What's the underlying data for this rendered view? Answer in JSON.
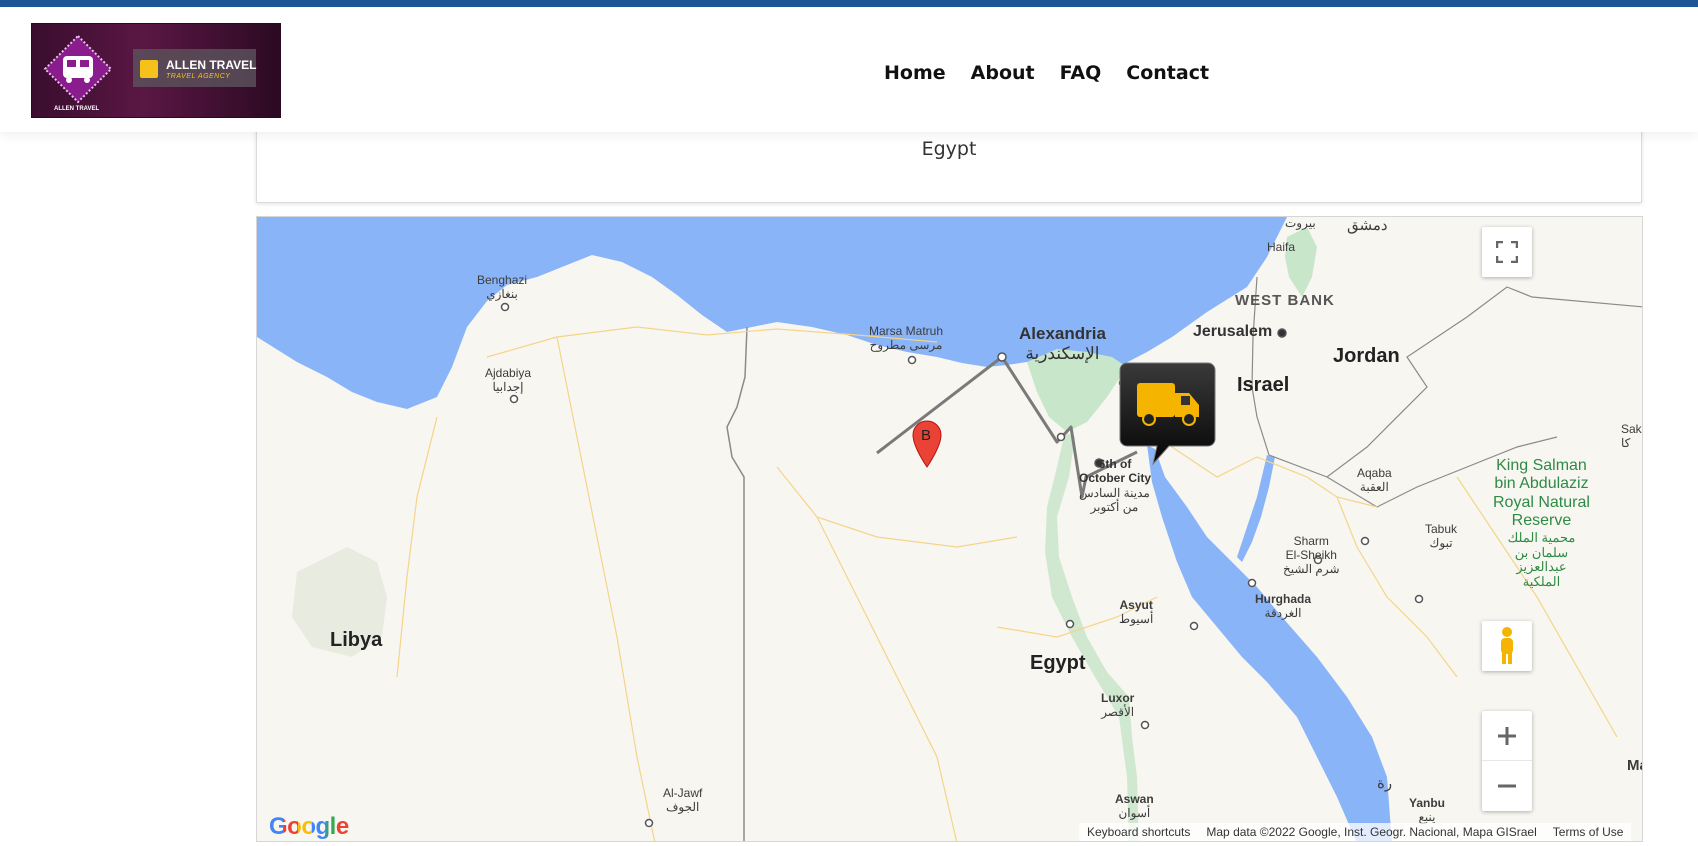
{
  "header": {
    "logo": {
      "brand_name": "ALLEN TRAVEL",
      "brand_tagline": "TRAVEL AGENCY",
      "badge_caption": "ALLEN TRAVEL"
    },
    "nav": [
      {
        "label": "Home"
      },
      {
        "label": "About"
      },
      {
        "label": "FAQ"
      },
      {
        "label": "Contact"
      }
    ]
  },
  "card": {
    "country": "Egypt"
  },
  "map": {
    "labels": {
      "damascus": "دمشق",
      "beirut": "بيروت",
      "haifa": "Haifa",
      "west_bank": "WEST BANK",
      "jerusalem": "Jerusalem",
      "jordan": "Jordan",
      "israel": "Israel",
      "benghazi": "Benghazi",
      "benghazi_ar": "بنغازي",
      "ajdabiya": "Ajdabiya",
      "ajdabiya_ar": "إجدابيا",
      "marsa_matruh": "Marsa Matruh",
      "marsa_matruh_ar": "مرسى مطروح",
      "alexandria": "Alexandria",
      "alexandria_ar": "الإسكندرية",
      "october_city_1": "6th of",
      "october_city_2": "October City",
      "october_city_ar_1": "مدينة السادس",
      "october_city_ar_2": "من أكتوبر",
      "aqaba": "Aqaba",
      "aqaba_ar": "العقبة",
      "tabuk": "Tabuk",
      "tabuk_ar": "تبوك",
      "sakaka": "Sak",
      "sakaka_ar": "كا",
      "king_salman_1": "King Salman",
      "king_salman_2": "bin Abdulaziz",
      "king_salman_3": "Royal Natural",
      "king_salman_4": "Reserve",
      "king_salman_ar_1": "محمية الملك",
      "king_salman_ar_2": "سلمان بن",
      "king_salman_ar_3": "عبدالعزيز",
      "king_salman_ar_4": "الملكية",
      "sharm_1": "Sharm",
      "sharm_2": "El-Sheikh",
      "sharm_ar": "شرم الشيخ",
      "hurghada": "Hurghada",
      "hurghada_ar": "الغردقة",
      "asyut": "Asyut",
      "asyut_ar": "أسيوط",
      "libya": "Libya",
      "egypt": "Egypt",
      "luxor": "Luxor",
      "luxor_ar": "الأقصر",
      "al_jawf": "Al-Jawf",
      "al_jawf_ar": "الجوف",
      "aswan": "Aswan",
      "aswan_ar": "أسوان",
      "yanbu": "Yanbu",
      "yanbu_ar": "ينبع",
      "edge_ar": "رة",
      "edge_ma": "Ma"
    },
    "marker_b_label": "B",
    "google_logo": "Google",
    "attribution": {
      "shortcuts": "Keyboard shortcuts",
      "map_data": "Map data ©2022 Google, Inst. Geogr. Nacional, Mapa GISrael",
      "terms": "Terms of Use"
    },
    "colors": {
      "water": "#8ab4f8",
      "land": "#f8f6f1",
      "route": "#7a7a7a",
      "marker": "#ea4335"
    }
  }
}
